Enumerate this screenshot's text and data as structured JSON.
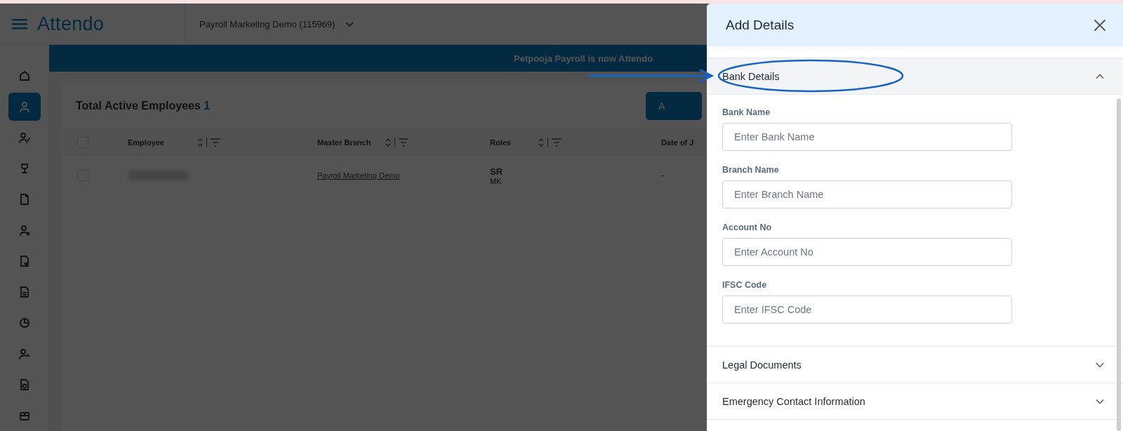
{
  "app_header": {
    "logo": "Attendo",
    "company": "Payroll Marketing Demo (115969)"
  },
  "sidebar": {
    "items": [
      {
        "selected": false
      },
      {
        "selected": true
      },
      {
        "selected": false
      },
      {
        "selected": false
      },
      {
        "selected": false
      },
      {
        "selected": false
      },
      {
        "selected": false
      },
      {
        "selected": false
      },
      {
        "selected": false
      },
      {
        "selected": false
      },
      {
        "selected": false
      },
      {
        "selected": false
      }
    ]
  },
  "banner": "Petpooja Payroll is now Attendo",
  "employees": {
    "title": "Total Active Employees",
    "count": "1",
    "button": "A",
    "select_all": {
      "checked": false
    },
    "columns": [
      "Employee",
      "Master Branch",
      "Roles",
      "Date of J"
    ],
    "rows": [
      {
        "checked": false,
        "name": {
          "kind": "blurred"
        },
        "master_branch": "Payroll Marketing Demo",
        "role": "SR",
        "role_sub": "MK",
        "column_4": "-"
      }
    ]
  },
  "drawer": {
    "title": "Add Details",
    "sections": [
      {
        "title": "Bank Details",
        "expanded": true,
        "fields": [
          {
            "label": "Bank Name",
            "placeholder": "Enter Bank Name"
          },
          {
            "label": "Branch Name",
            "placeholder": "Enter Branch Name"
          },
          {
            "label": "Account No",
            "placeholder": "Enter Account No"
          },
          {
            "label": "IFSC Code",
            "placeholder": "Enter IFSC Code"
          }
        ]
      },
      {
        "title": "Legal Documents",
        "expanded": false
      },
      {
        "title": "Emergency Contact Information",
        "expanded": false
      }
    ]
  },
  "annotations": {
    "arrow": true,
    "ellipse": true
  }
}
